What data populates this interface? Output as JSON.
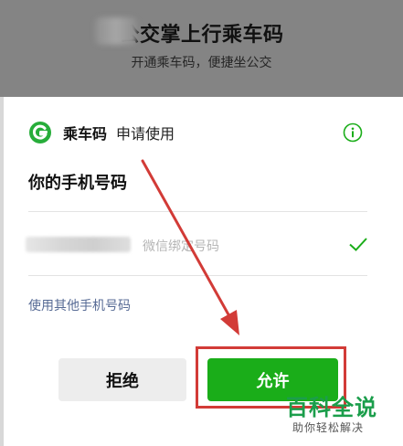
{
  "banner": {
    "title": "公交掌上行乘车码",
    "subtitle": "开通乘车码，便捷坐公交"
  },
  "auth": {
    "app_name": "乘车码",
    "request_text": "申请使用",
    "section_title": "你的手机号码",
    "phone_label": "微信绑定号码",
    "other_phone_link": "使用其他手机号码"
  },
  "buttons": {
    "reject": "拒绝",
    "allow": "允许"
  },
  "watermark": {
    "title": "百科全说",
    "subtitle": "助你轻松解决"
  },
  "colors": {
    "allow_green": "#1aad19",
    "link_blue": "#576b95",
    "annotation_red": "#d23b37"
  },
  "icons": [
    "app-logo-icon",
    "info-icon",
    "checkmark-icon"
  ]
}
